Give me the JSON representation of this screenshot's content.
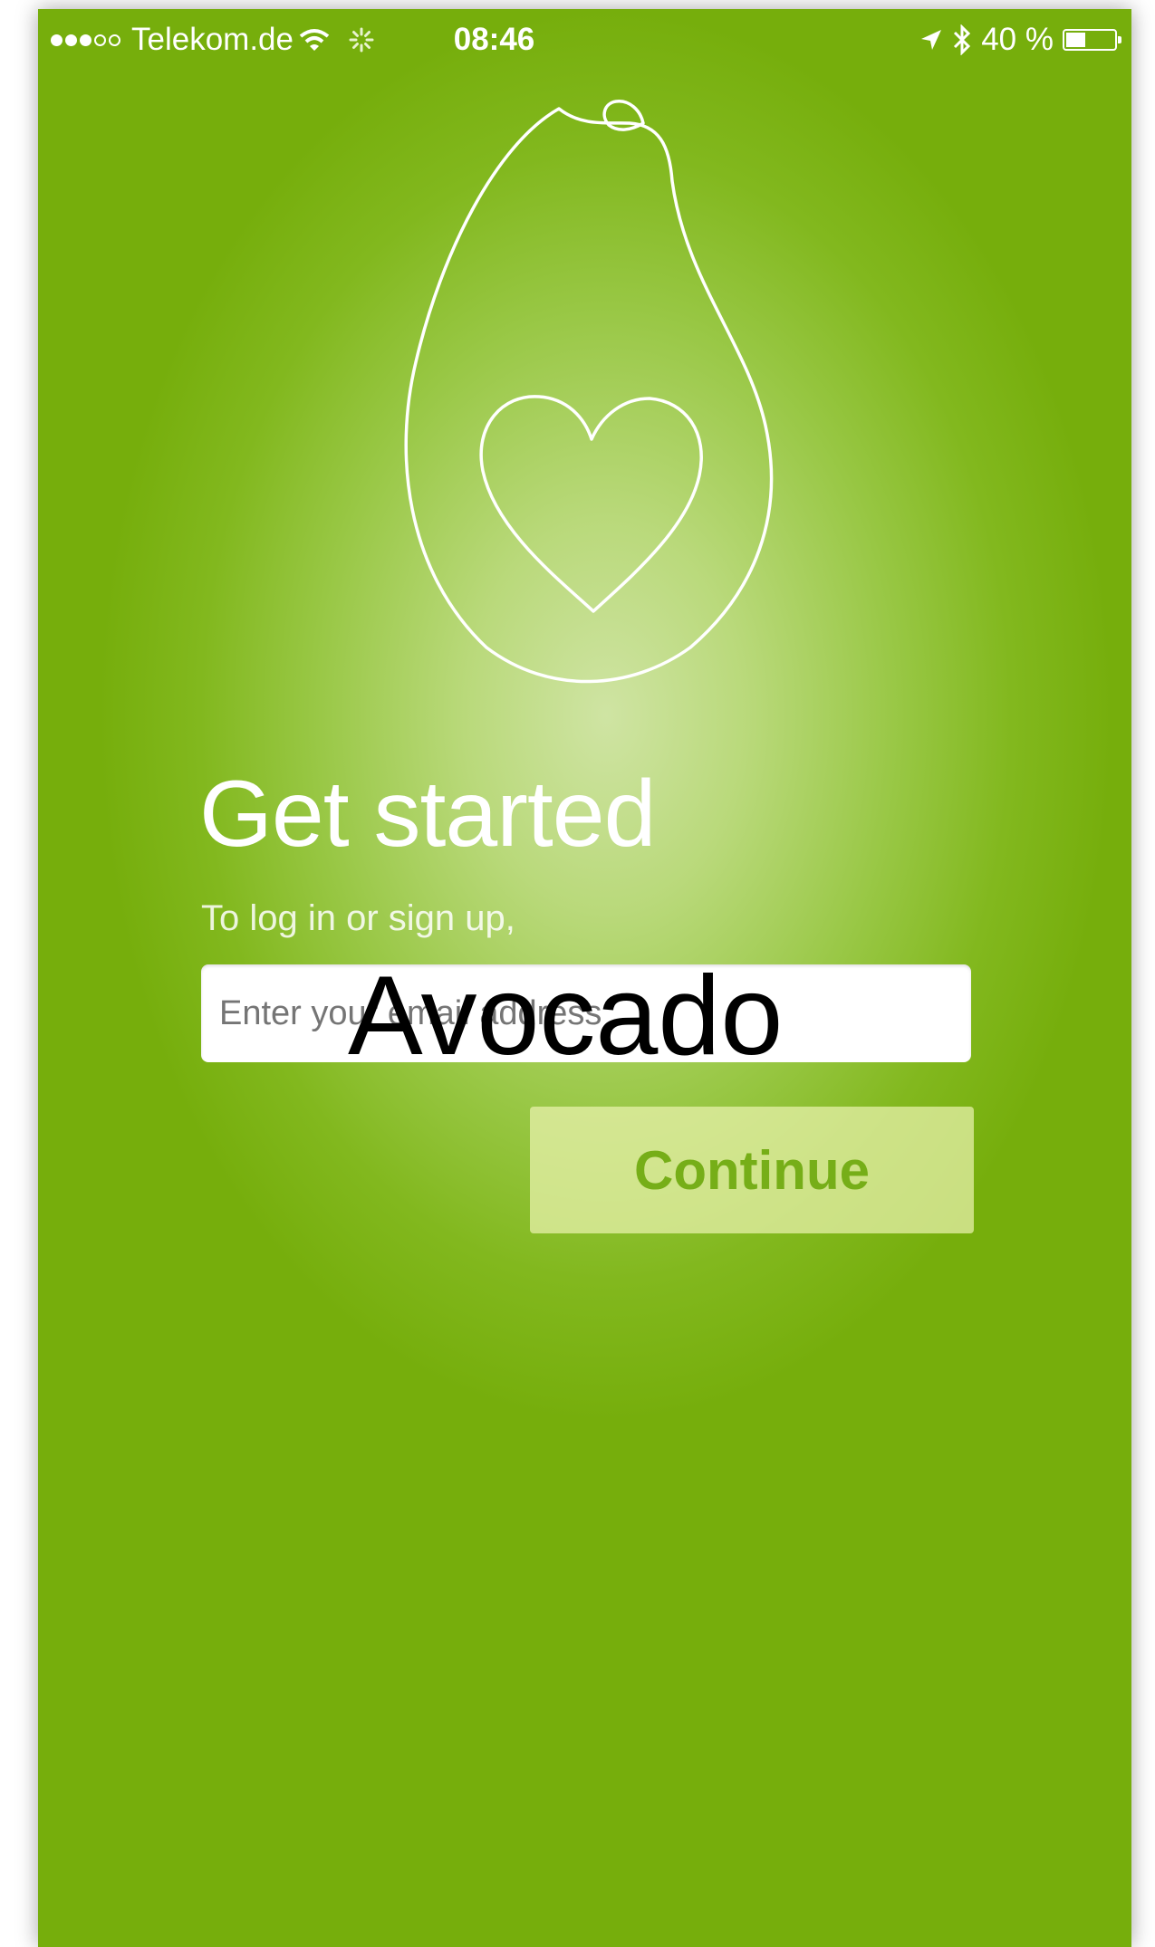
{
  "status_bar": {
    "carrier": "Telekom.de",
    "time": "08:46",
    "battery_percent": "40 %",
    "battery_level": 0.4,
    "signal_bars_filled": 3,
    "signal_bars_total": 5,
    "icons": [
      "wifi-icon",
      "activity-spinner-icon",
      "location-arrow-icon",
      "bluetooth-icon",
      "battery-icon"
    ]
  },
  "logo": {
    "icon": "avocado-heart-icon"
  },
  "onboarding": {
    "title": "Get started",
    "subtitle": "To log in or sign up,",
    "email_placeholder": "Enter your email address",
    "overlay_label": "Avocado",
    "continue_label": "Continue"
  },
  "colors": {
    "background_green": "#7cb518",
    "background_highlight": "#cfe4a3",
    "button_background": "#eaf3ae",
    "button_text": "#76ae18",
    "text_white": "#ffffff"
  }
}
